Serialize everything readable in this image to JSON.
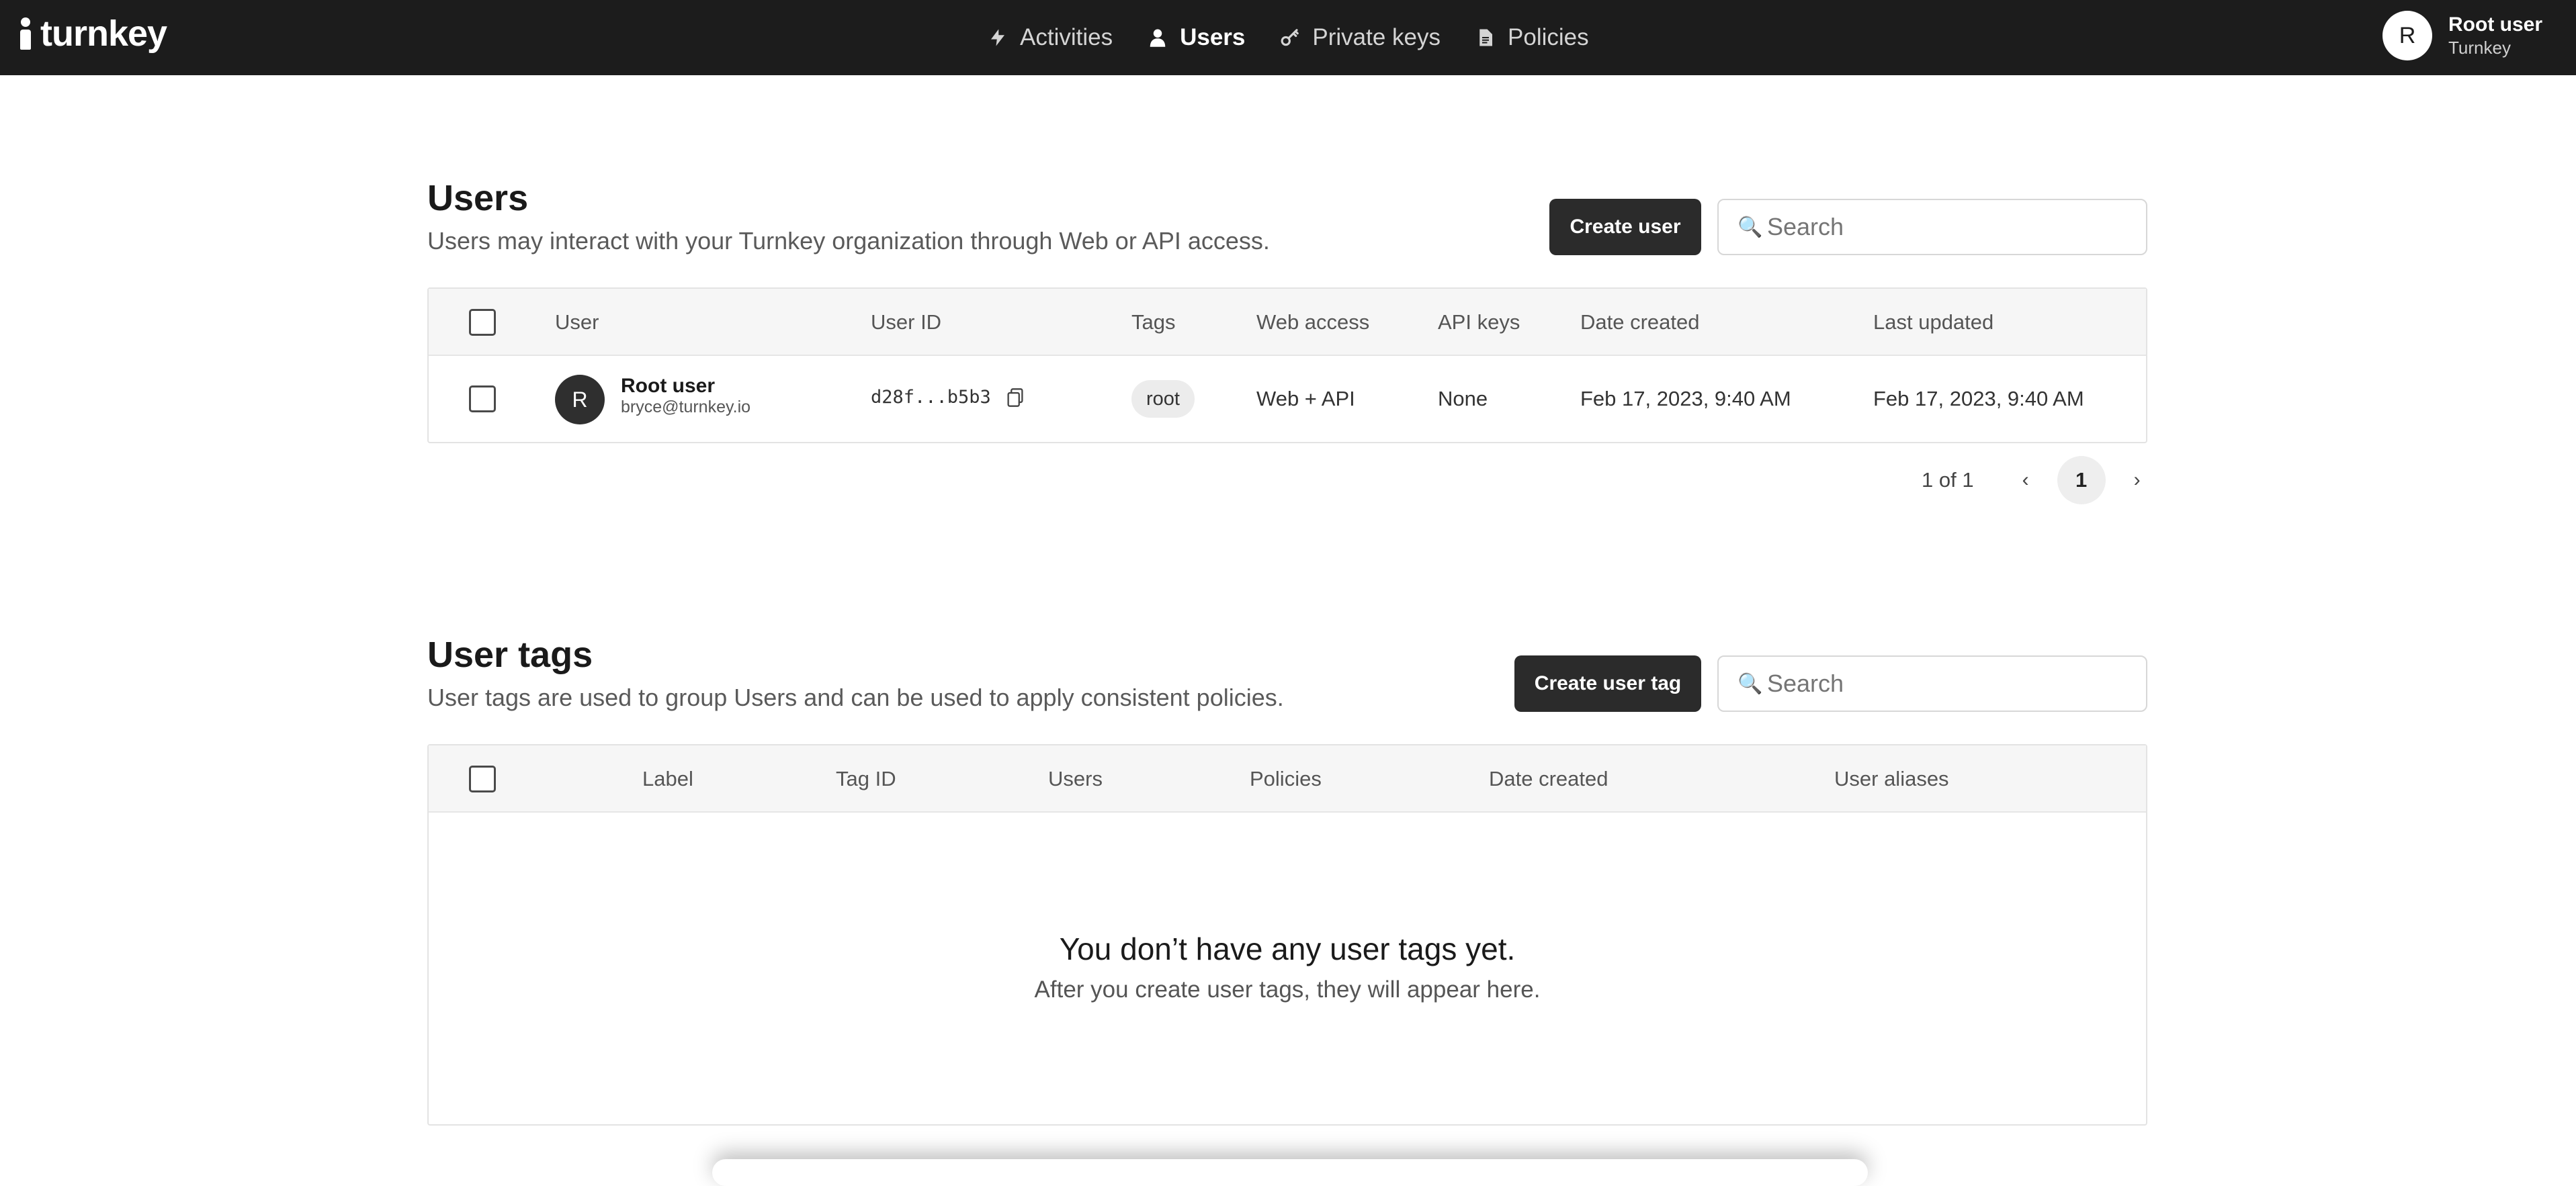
{
  "app": {
    "brand": "turnkey"
  },
  "nav": {
    "items": [
      {
        "label": "Activities",
        "icon": "lightning-icon",
        "active": false
      },
      {
        "label": "Users",
        "icon": "user-icon",
        "active": true
      },
      {
        "label": "Private keys",
        "icon": "key-icon",
        "active": false
      },
      {
        "label": "Policies",
        "icon": "document-icon",
        "active": false
      }
    ]
  },
  "profile": {
    "initial": "R",
    "name": "Root user",
    "org": "Turnkey"
  },
  "users_section": {
    "title": "Users",
    "description": "Users may interact with your Turnkey organization through Web or API access.",
    "create_label": "Create user",
    "search_placeholder": "Search",
    "columns": [
      "User",
      "User ID",
      "Tags",
      "Web access",
      "API keys",
      "Date created",
      "Last updated"
    ],
    "rows": [
      {
        "initial": "R",
        "name": "Root user",
        "email": "bryce@turnkey.io",
        "user_id": "d28f...b5b3",
        "tag": "root",
        "web_access": "Web + API",
        "api_keys": "None",
        "date_created": "Feb 17, 2023, 9:40 AM",
        "last_updated": "Feb 17, 2023, 9:40 AM"
      }
    ],
    "pagination": {
      "label": "1 of 1",
      "current_page": "1",
      "prev_icon": "chevron-left-icon",
      "next_icon": "chevron-right-icon"
    }
  },
  "tags_section": {
    "title": "User tags",
    "description": "User tags are used to group Users and can be used to apply consistent policies.",
    "create_label": "Create user tag",
    "search_placeholder": "Search",
    "columns": [
      "Label",
      "Tag ID",
      "Users",
      "Policies",
      "Date created",
      "User aliases"
    ],
    "empty_title": "You don’t have any user tags yet.",
    "empty_subtitle": "After you create user tags, they will appear here."
  }
}
